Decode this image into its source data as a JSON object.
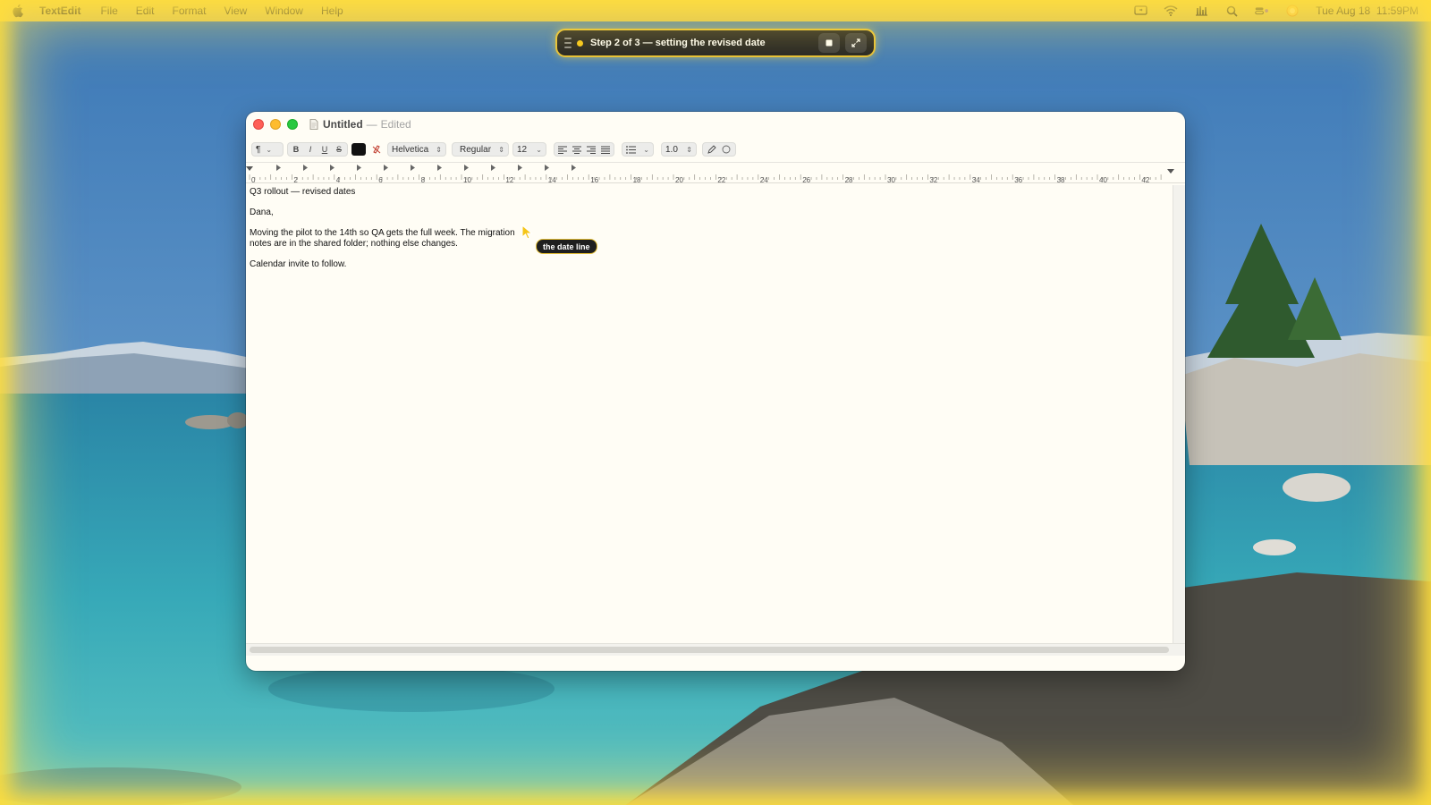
{
  "menubar": {
    "app_name": "TextEdit",
    "items": [
      "File",
      "Edit",
      "Format",
      "View",
      "Window",
      "Help"
    ],
    "clock": "Tue Aug 18  11:59PM",
    "status_icons": [
      "screen-share-icon",
      "wifi-icon",
      "activity-icon",
      "search-icon",
      "control-center-icon",
      "siri-icon"
    ]
  },
  "agent_pill": {
    "step_text": "Step 2 of 3 — setting the revised date",
    "status_color": "#f5c518",
    "buttons": [
      "stop-icon",
      "expand-icon"
    ]
  },
  "window": {
    "title": "Untitled",
    "separator": "—",
    "status": "Edited"
  },
  "toolbar": {
    "paragraph_symbol": "¶",
    "bold": "B",
    "italic": "I",
    "underline": "U",
    "strike": "S",
    "text_color": "#111111",
    "font_family": "Helvetica",
    "font_style": "Regular",
    "font_size": "12",
    "line_spacing": "1.0"
  },
  "ruler": {
    "labels": [
      "0",
      "2",
      "4",
      "6",
      "8",
      "10",
      "12",
      "14",
      "16",
      "18",
      "20",
      "22",
      "24",
      "26",
      "28",
      "30",
      "32",
      "34",
      "36",
      "38",
      "40",
      "42"
    ]
  },
  "document": {
    "heading": "Q3 rollout — revised dates",
    "salutation": "Dana,",
    "body_line_1": "Moving the pilot to the 14th so QA gets the full week. The migration",
    "body_line_2": "notes are in the shared folder; nothing else changes.",
    "closing": "Calendar invite to follow."
  },
  "tooltip": {
    "text": "the date line"
  },
  "colors": {
    "accent_glow": "#f5d13a",
    "window_bg": "#fffdf5"
  }
}
